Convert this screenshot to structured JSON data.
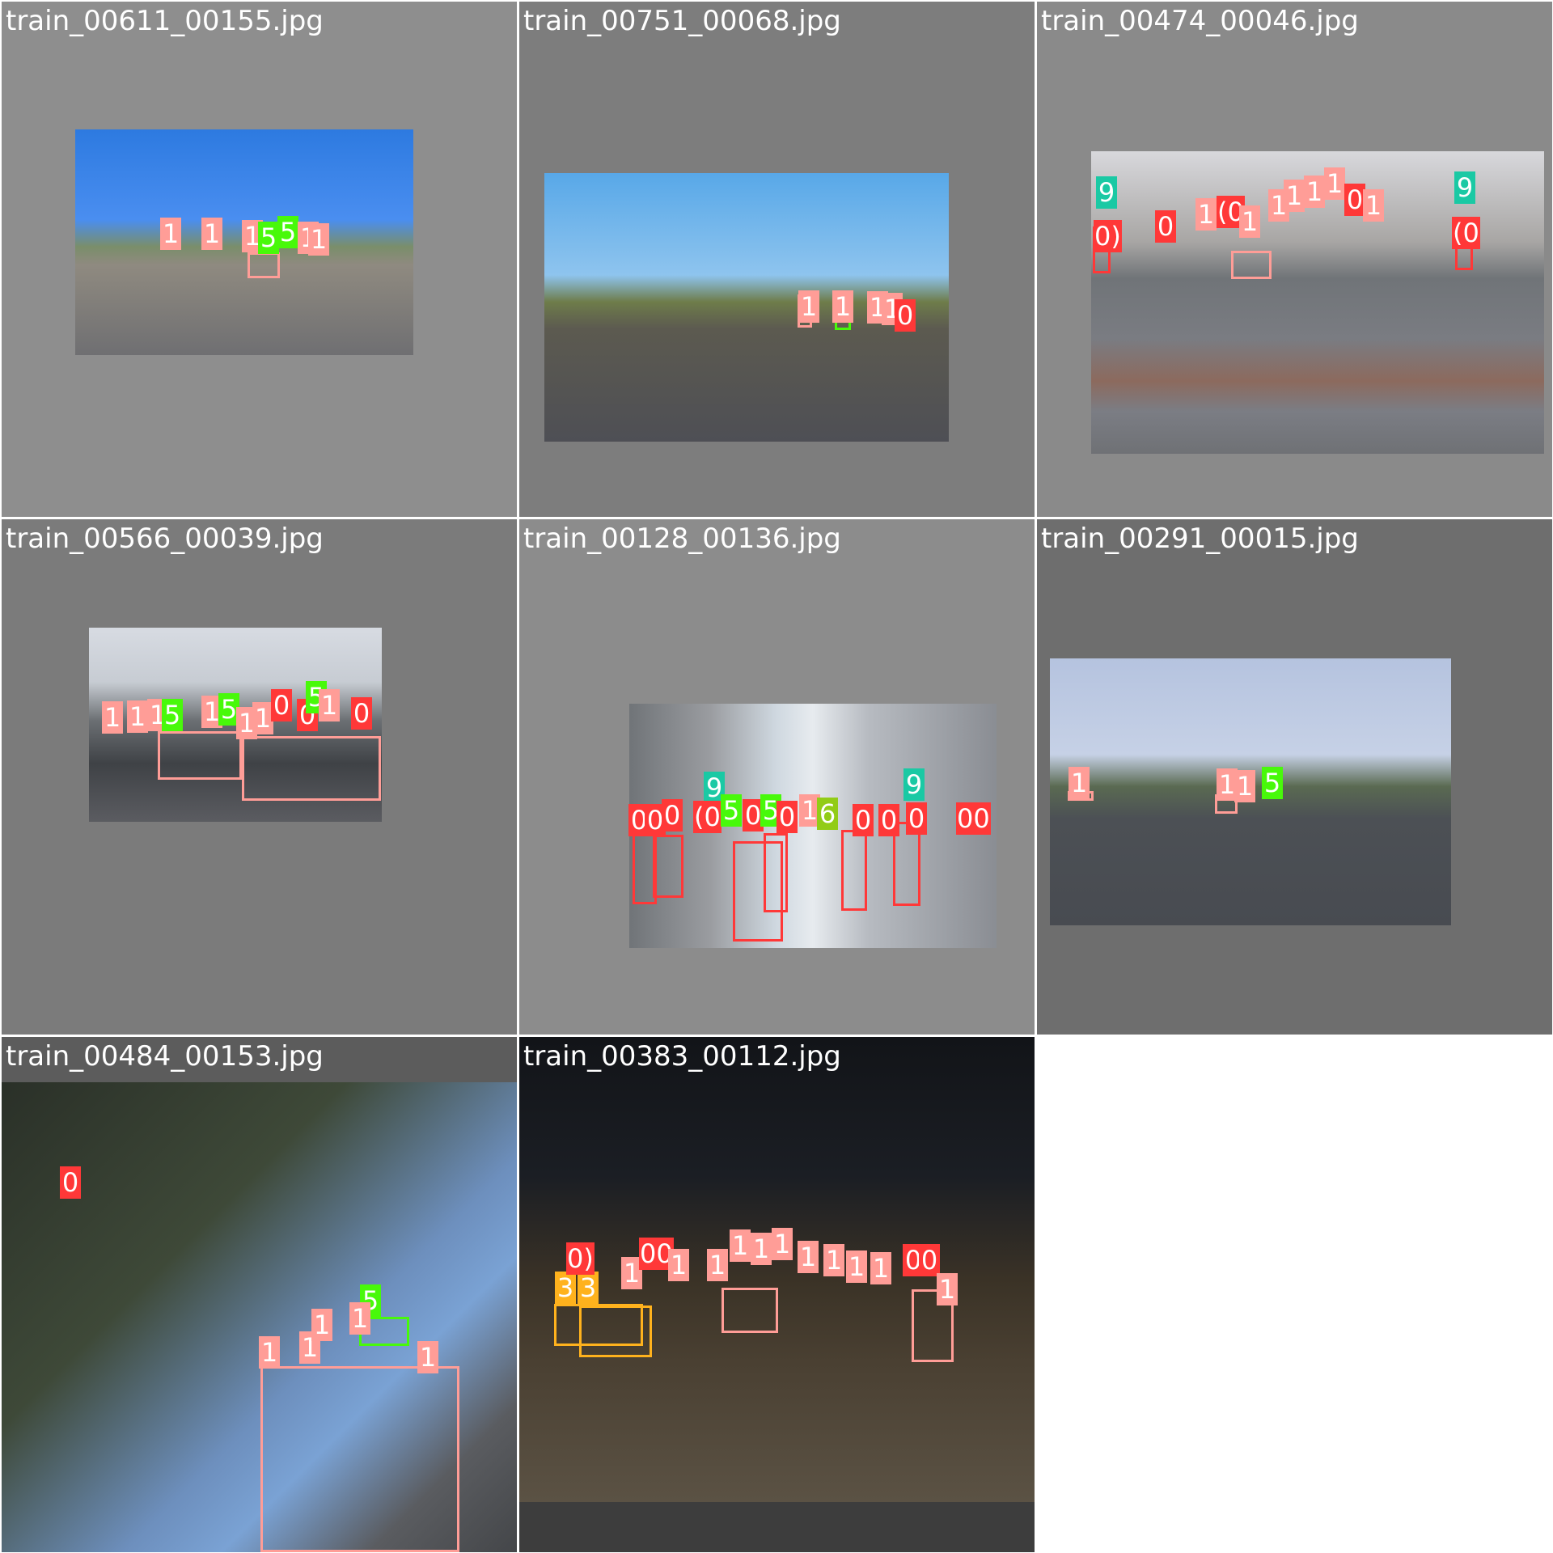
{
  "mosaic": {
    "tiles": [
      {
        "name": "train_00611_00155.jpg"
      },
      {
        "name": "train_00751_00068.jpg"
      },
      {
        "name": "train_00474_00046.jpg"
      },
      {
        "name": "train_00566_00039.jpg"
      },
      {
        "name": "train_00128_00136.jpg"
      },
      {
        "name": "train_00291_00015.jpg"
      },
      {
        "name": "train_00484_00153.jpg"
      },
      {
        "name": "train_00383_00112.jpg"
      }
    ],
    "class_colors": {
      "0": "#ff3838",
      "1": "#ff9d97",
      "3": "#ffb21d",
      "5": "#48f90a",
      "6": "#92cc17",
      "9": "#1ac9a4"
    }
  }
}
